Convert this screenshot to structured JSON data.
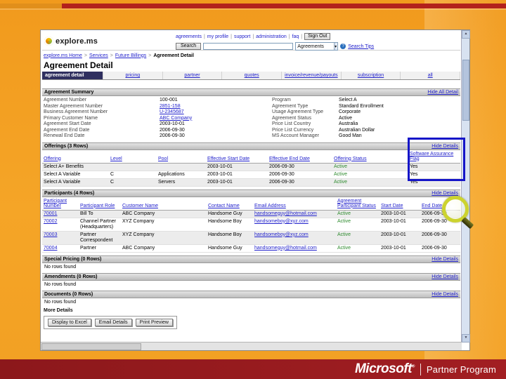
{
  "colors": {
    "slide_orange": "#f5a527",
    "stripe_red": "#b2211c",
    "footer_maroon": "#9e1d20",
    "link_blue": "#2222cc",
    "active_status_green": "#2e8b2e",
    "highlight_blue": "#1515c8"
  },
  "slide": {
    "footer": {
      "brand": "Microsoft",
      "registered": "®",
      "program": "Partner Program"
    }
  },
  "app": {
    "logo_text": "explore.ms",
    "top_nav": {
      "links": [
        "agreements",
        "my profile",
        "support",
        "administration",
        "faq"
      ],
      "sign_out_label": "Sign Out"
    },
    "search": {
      "button_label": "Search",
      "input_value": "",
      "scope_value": "Agreements",
      "tips_label": "Search Tips"
    },
    "breadcrumb": [
      "explore.ms Home",
      "Services",
      "Future Billings",
      "Agreement Detail"
    ],
    "page_title": "Agreement Detail",
    "tabs": [
      "agreement detail",
      "pricing",
      "partner",
      "quotes",
      "invoice/revenue/payouts",
      "subscription",
      "all"
    ],
    "summary": {
      "title": "Agreement Summary",
      "action": "Hide All Detail",
      "left": [
        {
          "label": "Agreement Number",
          "value": "100-001"
        },
        {
          "label": "Master Agreement Number",
          "value": "2851-158",
          "link": true
        },
        {
          "label": "Business Agreement Number",
          "value": "U-2345687",
          "link": true
        },
        {
          "label": "Primary Customer Name",
          "value": "ABC Company",
          "link": true
        },
        {
          "label": "Agreement Start Date",
          "value": "2003-10-01"
        },
        {
          "label": "Agreement End Date",
          "value": "2006-09-30"
        },
        {
          "label": "Renewal End Date",
          "value": "2006-09-30"
        }
      ],
      "right": [
        {
          "label": "Program",
          "value": "Select A"
        },
        {
          "label": "Agreement Type",
          "value": "Standard Enrollment"
        },
        {
          "label": "Usage Agreement Type",
          "value": "Corporate"
        },
        {
          "label": "Agreement Status",
          "value": "Active"
        },
        {
          "label": "Price List Country",
          "value": "Australia"
        },
        {
          "label": "Price List Currency",
          "value": "Australian Dollar"
        },
        {
          "label": "MS Account Manager",
          "value": "Good Man"
        }
      ]
    },
    "offerings": {
      "title": "Offerings (3 Rows)",
      "action": "Hide Details",
      "columns": [
        "Offering",
        "Level",
        "Pool",
        "Effective Start Date",
        "Effective End Date",
        "Offering Status",
        "Software Assurance Flag"
      ],
      "rows": [
        [
          "Select A+ Benefits",
          "",
          "",
          "2003-10-01",
          "2006-09-30",
          "Active",
          "Yes"
        ],
        [
          "Select A Variable",
          "C",
          "Applications",
          "2003-10-01",
          "2006-09-30",
          "Active",
          "Yes"
        ],
        [
          "Select A Variable",
          "C",
          "Servers",
          "2003-10-01",
          "2006-09-30",
          "Active",
          "Yes"
        ]
      ]
    },
    "participants": {
      "title": "Participants (4 Rows)",
      "action": "Hide Details",
      "columns": [
        "Participant Number",
        "Participant Role",
        "Customer Name",
        "Contact Name",
        "Email Address",
        "Agreement Participant Status",
        "Start Date",
        "End Date"
      ],
      "rows": [
        [
          "70001",
          "Bill To",
          "ABC Company",
          "Handsome Guy",
          "handsomeguy@hotmail.com",
          "Active",
          "2003-10-01",
          "2006-09-30"
        ],
        [
          "70002",
          "Channel Partner (Headquarters)",
          "XYZ Company",
          "Handsome Boy",
          "handsomeboy@xyz.com",
          "Active",
          "2003-10-01",
          "2006-09-30"
        ],
        [
          "70003",
          "Partner Correspondent",
          "XYZ Company",
          "Handsome Boy",
          "handsomeboy@xyz.com",
          "Active",
          "2003-10-01",
          "2006-09-30"
        ],
        [
          "70004",
          "Partner",
          "ABC Company",
          "Handsome Guy",
          "handsomeguy@hotmail.com",
          "Active",
          "2003-10-01",
          "2006-09-30"
        ]
      ]
    },
    "special_pricing": {
      "title": "Special Pricing (0 Rows)",
      "action": "Hide Details",
      "empty_text": "No rows found"
    },
    "amendments": {
      "title": "Amendments (0 Rows)",
      "action": "Hide Details",
      "empty_text": "No rows found"
    },
    "documents": {
      "title": "Documents (0 Rows)",
      "action": "Hide Details",
      "empty_text": "No rows found"
    },
    "more_details": {
      "title": "More Details",
      "buttons": [
        "Display to Excel",
        "Email Details",
        "Print Preview"
      ]
    }
  }
}
